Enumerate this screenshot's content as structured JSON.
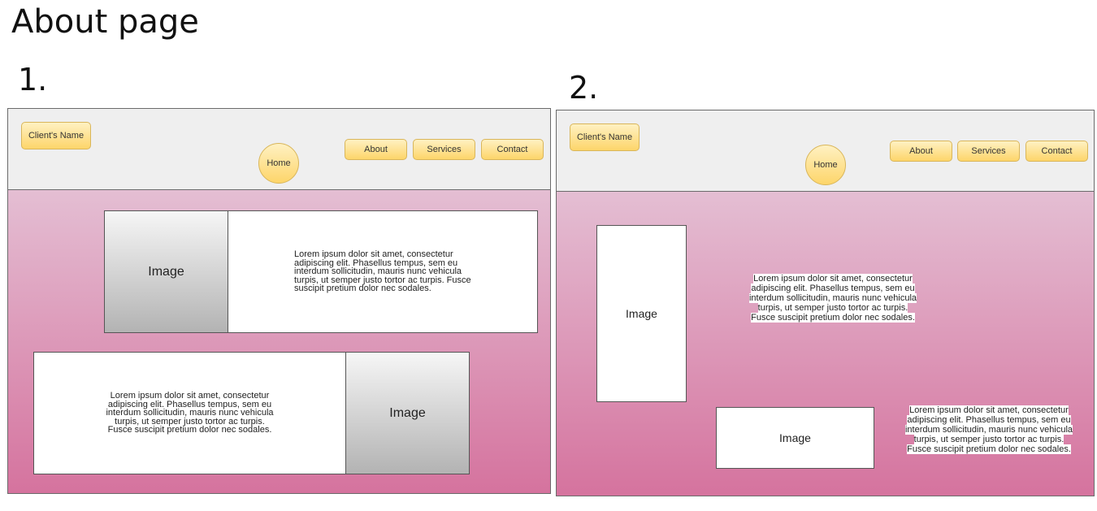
{
  "title": "About page",
  "mockups": [
    {
      "number": "1.",
      "client_name": "Client's Name",
      "home": "Home",
      "nav": [
        "About",
        "Services",
        "Contact"
      ],
      "rows": [
        {
          "image_label": "Image",
          "text": "Lorem ipsum dolor sit amet, consectetur adipiscing elit. Phasellus tempus, sem eu interdum sollicitudin, mauris nunc vehicula turpis, ut semper justo tortor ac turpis. Fusce suscipit pretium dolor nec sodales."
        },
        {
          "image_label": "Image",
          "text": "Lorem ipsum dolor sit amet, consectetur adipiscing elit. Phasellus tempus, sem eu interdum sollicitudin, mauris nunc vehicula turpis, ut semper justo tortor ac turpis. Fusce suscipit pretium dolor nec sodales."
        }
      ]
    },
    {
      "number": "2.",
      "client_name": "Client's Name",
      "home": "Home",
      "nav": [
        "About",
        "Services",
        "Contact"
      ],
      "rows": [
        {
          "image_label": "Image",
          "text": "Lorem ipsum dolor sit amet, consectetur adipiscing elit. Phasellus tempus, sem eu interdum sollicitudin, mauris nunc vehicula turpis, ut semper justo tortor ac turpis. Fusce suscipit pretium dolor nec sodales."
        },
        {
          "image_label": "Image",
          "text": "Lorem ipsum dolor sit amet, consectetur adipiscing elit. Phasellus tempus, sem eu interdum sollicitudin, mauris nunc vehicula turpis, ut semper justo tortor ac turpis. Fusce suscipit pretium dolor nec sodales."
        }
      ]
    }
  ],
  "colors": {
    "button_fill": "#fdd56a",
    "header_bg": "#efefef",
    "gradient_top": "#e4bed3",
    "gradient_bottom": "#d5739e"
  }
}
